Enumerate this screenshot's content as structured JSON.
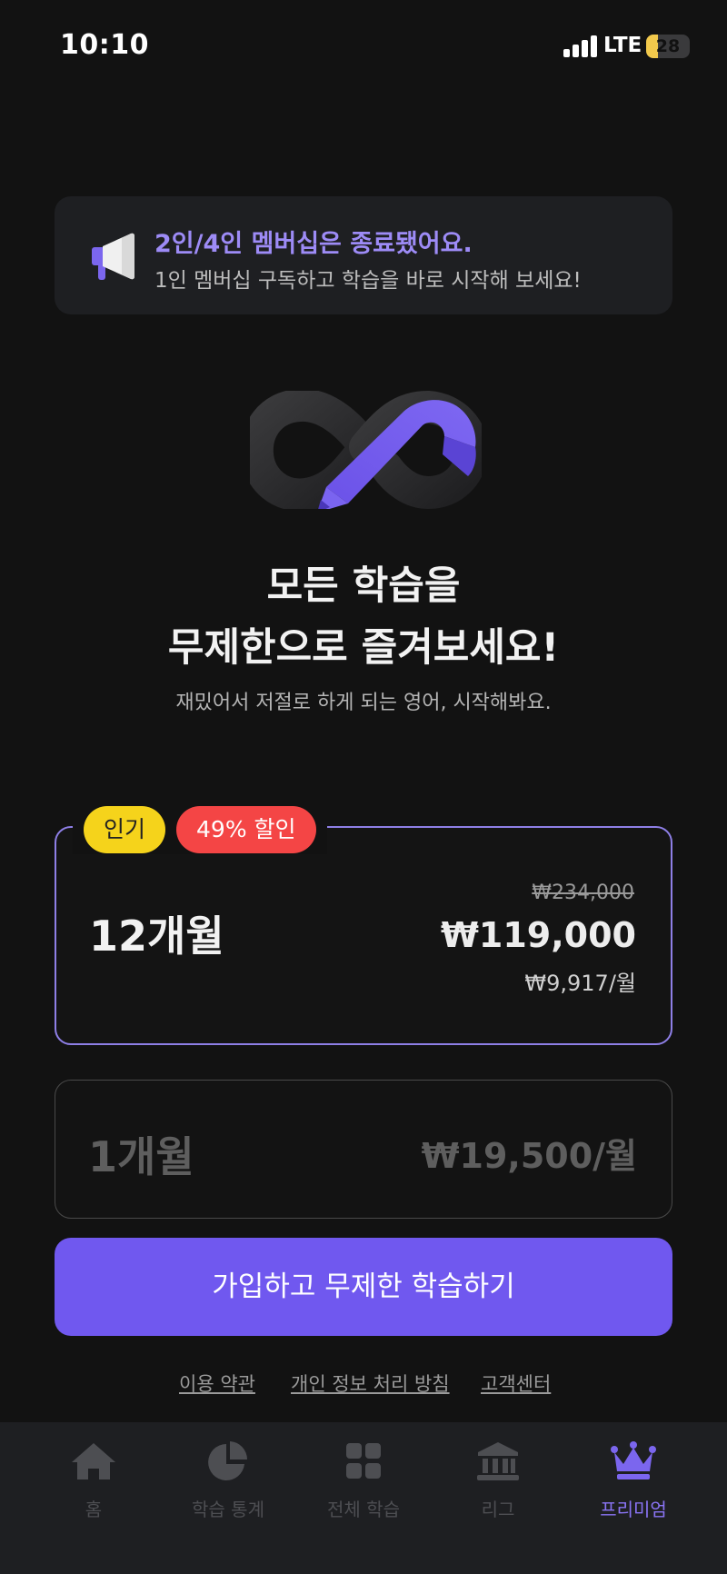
{
  "status_bar": {
    "time": "10:10",
    "network": "LTE",
    "battery": "28",
    "battery_level": 0.28
  },
  "notice": {
    "icon": "megaphone-icon",
    "title": "2인/4인 멤버십은 종료됐어요.",
    "subtitle": "1인 멤버십 구독하고 학습을 바로 시작해 보세요!"
  },
  "hero": {
    "logo": "infinity-pencil-logo",
    "title_line1": "모든 학습을",
    "title_line2": "무제한으로 즐겨보세요!",
    "subtitle": "재밌어서 저절로 하게 되는 영어, 시작해봐요."
  },
  "plans": {
    "yearly": {
      "badge_popular": "인기",
      "badge_discount": "49% 할인",
      "label": "12개월",
      "original_price": "₩234,000",
      "price": "₩119,000",
      "per_month": "₩9,917/월",
      "selected": true
    },
    "monthly": {
      "label": "1개월",
      "price": "₩19,500/월",
      "selected": false
    }
  },
  "cta": {
    "label": "가입하고 무제한 학습하기"
  },
  "footer": {
    "terms": "이용 약관",
    "privacy": "개인 정보 처리 방침",
    "support": "고객센터"
  },
  "tabs": [
    {
      "label": "홈",
      "icon": "home-icon"
    },
    {
      "label": "학습 통계",
      "icon": "pie-chart-icon"
    },
    {
      "label": "전체 학습",
      "icon": "grid-icon"
    },
    {
      "label": "리그",
      "icon": "bank-icon"
    },
    {
      "label": "프리미엄",
      "icon": "crown-icon",
      "active": true
    }
  ],
  "colors": {
    "background": "#121212",
    "accent": "#7058ef",
    "accent_light": "#9d8bf6",
    "badge_yellow": "#f5d31b",
    "badge_red": "#f44545"
  }
}
